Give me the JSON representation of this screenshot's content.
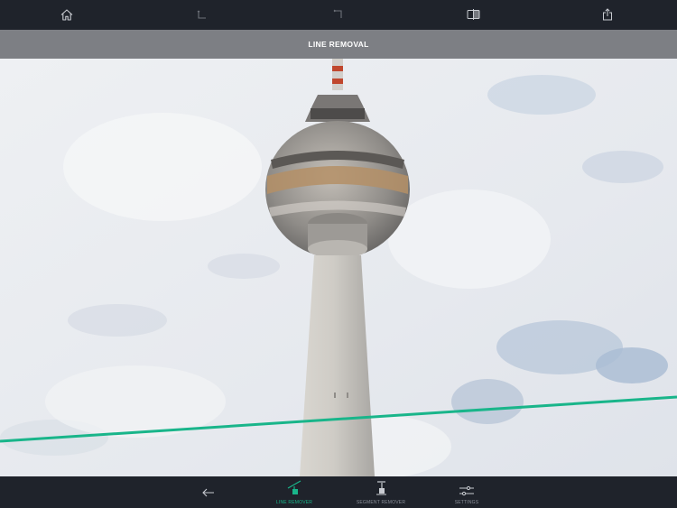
{
  "header": {
    "title": "LINE REMOVAL",
    "icons": [
      "home-icon",
      "undo-icon",
      "redo-icon",
      "compare-icon",
      "share-icon"
    ]
  },
  "toolbar": {
    "back_icon": "arrow-left-icon",
    "tools": [
      {
        "label": "LINE REMOVER",
        "icon": "line-remover-icon",
        "active": true
      },
      {
        "label": "SEGMENT REMOVER",
        "icon": "segment-remover-icon",
        "active": false
      },
      {
        "label": "SETTINGS",
        "icon": "sliders-icon",
        "active": false
      }
    ]
  },
  "colors": {
    "bar": "#1f232b",
    "title_bar": "#7d7f84",
    "accent": "#19b58a",
    "icon": "#c9ccd2"
  }
}
